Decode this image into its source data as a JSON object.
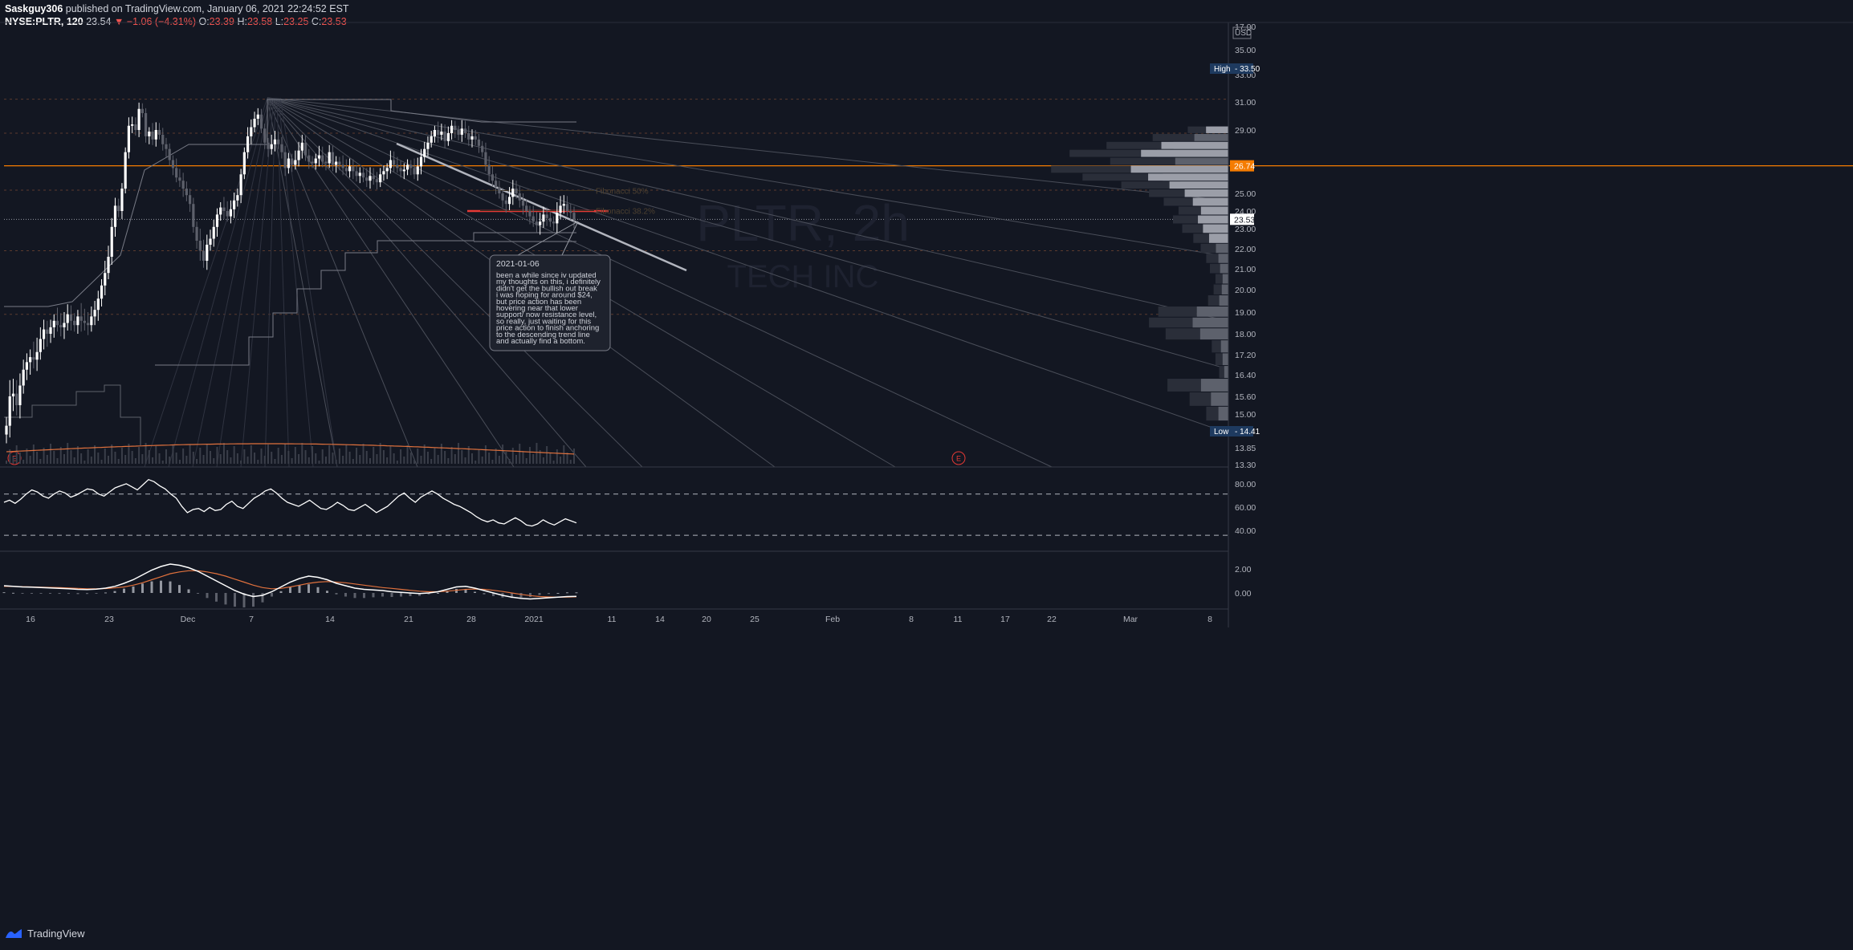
{
  "header": {
    "author": "Saskguy306",
    "published_text": " published on TradingView.com, January 06, 2021 22:24:52 EST",
    "symbol": "NYSE:PLTR, 120",
    "last": "23.54",
    "change": "▼ −1.06 (−4.31%)",
    "o_label": "O:",
    "o_value": "23.39",
    "h_label": "H:",
    "h_value": "23.58",
    "l_label": "L:",
    "l_value": "23.25",
    "c_label": "C:",
    "c_value": "23.53"
  },
  "footer": {
    "brand": "TradingView"
  },
  "colors": {
    "background": "#131722",
    "up_candle": "#ffffff",
    "down_candle": "#5d606b",
    "resistance_line": "#f57c00",
    "red_level": "#e53935",
    "grid_dotted": "#5b3a2e",
    "rsi_line": "#ffffff",
    "macd_line": "#ffffff",
    "signal_line": "#e0713d",
    "volume_ma": "#e0713d"
  },
  "chart_data": {
    "type": "candlestick",
    "symbol": "NYSE:PLTR",
    "interval": "120",
    "currency": "USD",
    "price_axis_ticks": [
      "17.00",
      "35.00",
      "33.00",
      "31.00",
      "29.00",
      "25.00",
      "24.00",
      "23.00",
      "22.00",
      "21.00",
      "20.00",
      "19.00",
      "18.00",
      "17.20",
      "16.40",
      "15.60",
      "15.00",
      "13.85",
      "13.30"
    ],
    "x_tick_labels": [
      "16",
      "23",
      "Dec",
      "7",
      "14",
      "21",
      "28",
      "2021",
      "11",
      "14",
      "20",
      "25",
      "Feb",
      "8",
      "11",
      "17",
      "22",
      "Mar",
      "8"
    ],
    "last_price": 23.53,
    "last_price_label": "23.53",
    "high_label": "High",
    "high_value": "33.50",
    "low_label": "Low",
    "low_value": "14.41",
    "resistance_label": "26.74",
    "resistance_value": 26.74,
    "red_level_value": 24.0,
    "fib_labels": [
      "Fibonacci 50%",
      "Fibonacci 38.2%"
    ],
    "fib_levels": [
      25.18,
      24.02
    ],
    "dotted_levels": [
      31.2,
      28.8,
      25.2,
      21.9,
      18.9
    ],
    "watermark_text": "PLTR, 2h",
    "watermark_subtext": "TECH INC",
    "earnings_marker": "E",
    "note_date": "2021-01-06",
    "note_text": "been a while since iv updated my thoughts on this, i definitely didn't get the bullish out break i was hoping for around $24, but price action has been hovering near that lower support/ now resistance level, so really, just waiting for this price action to finish anchoring to the descending trend line and actually find a bottom.",
    "note_lines": [
      "been a while since iv updated",
      "my thoughts on this, i definitely",
      "didn't get the bullish out break",
      "i was hoping for around $24,",
      "but price action has been",
      "hovering near that lower",
      "support/ now resistance level,",
      "so really, just waiting for this",
      "price action to finish anchoring",
      "to the descending trend line",
      "and actually find a bottom."
    ],
    "closes": [
      14.6,
      15.6,
      15.7,
      15.3,
      16.0,
      16.6,
      16.9,
      17.1,
      17.0,
      17.3,
      17.8,
      18.2,
      18.0,
      18.3,
      18.6,
      18.4,
      18.3,
      18.5,
      18.9,
      18.6,
      18.4,
      18.8,
      18.6,
      18.5,
      18.4,
      18.8,
      19.1,
      19.6,
      20.2,
      20.8,
      21.6,
      23.1,
      24.3,
      24.0,
      25.3,
      27.6,
      29.3,
      29.4,
      29.0,
      30.5,
      30.2,
      28.6,
      28.9,
      28.4,
      29.0,
      28.7,
      28.1,
      27.8,
      27.1,
      26.6,
      26.0,
      25.8,
      25.3,
      24.9,
      24.4,
      23.1,
      22.4,
      21.9,
      21.4,
      22.2,
      22.5,
      23.1,
      23.8,
      24.2,
      24.0,
      23.7,
      24.1,
      24.6,
      24.9,
      26.2,
      27.6,
      28.6,
      29.2,
      29.8,
      30.1,
      29.1,
      28.2,
      27.8,
      28.1,
      28.4,
      28.1,
      27.6,
      26.6,
      27.2,
      26.8,
      27.1,
      27.7,
      28.2,
      27.4,
      27.0,
      26.9,
      27.2,
      27.4,
      27.0,
      26.9,
      27.6,
      26.8,
      27.0,
      26.8,
      26.6,
      26.4,
      26.7,
      26.4,
      26.1,
      26.3,
      26.0,
      25.8,
      26.1,
      25.9,
      25.7,
      26.2,
      26.4,
      26.6,
      27.1,
      26.8,
      26.6,
      26.4,
      26.5,
      26.8,
      26.6,
      26.2,
      26.7,
      27.3,
      27.8,
      28.2,
      28.6,
      29.0,
      28.7,
      28.9,
      28.3,
      28.8,
      29.3,
      29.0,
      28.7,
      29.1,
      28.8,
      28.4,
      28.6,
      28.4,
      28.0,
      27.6,
      26.8,
      26.2,
      25.8,
      25.4,
      25.0,
      24.6,
      24.4,
      24.8,
      25.3,
      25.0,
      24.6,
      24.3,
      24.0,
      23.7,
      23.4,
      23.2,
      23.4,
      23.8,
      23.6,
      23.4,
      23.3,
      23.9,
      24.3,
      24.4,
      24.0,
      23.9,
      23.53
    ],
    "volume_profile_bins": [
      {
        "price": 29.0,
        "volume": 0.22
      },
      {
        "price": 28.5,
        "volume": 0.41
      },
      {
        "price": 28.0,
        "volume": 0.66
      },
      {
        "price": 27.5,
        "volume": 0.86
      },
      {
        "price": 27.0,
        "volume": 0.64
      },
      {
        "price": 26.5,
        "volume": 0.96
      },
      {
        "price": 26.0,
        "volume": 0.79
      },
      {
        "price": 25.5,
        "volume": 0.58
      },
      {
        "price": 25.0,
        "volume": 0.43
      },
      {
        "price": 24.5,
        "volume": 0.35
      },
      {
        "price": 24.0,
        "volume": 0.27
      },
      {
        "price": 23.5,
        "volume": 0.3
      },
      {
        "price": 23.0,
        "volume": 0.25
      },
      {
        "price": 22.5,
        "volume": 0.19
      },
      {
        "price": 22.0,
        "volume": 0.15
      },
      {
        "price": 21.5,
        "volume": 0.12
      },
      {
        "price": 21.0,
        "volume": 0.1
      },
      {
        "price": 20.5,
        "volume": 0.07
      },
      {
        "price": 20.0,
        "volume": 0.08
      },
      {
        "price": 19.5,
        "volume": 0.11
      },
      {
        "price": 19.0,
        "volume": 0.38
      },
      {
        "price": 18.5,
        "volume": 0.43
      },
      {
        "price": 18.0,
        "volume": 0.34
      },
      {
        "price": 17.5,
        "volume": 0.09
      },
      {
        "price": 17.0,
        "volume": 0.07
      },
      {
        "price": 16.5,
        "volume": 0.05
      },
      {
        "price": 16.0,
        "volume": 0.33
      },
      {
        "price": 15.5,
        "volume": 0.21
      },
      {
        "price": 15.0,
        "volume": 0.12
      }
    ],
    "rsi": {
      "levels": [
        70,
        30
      ],
      "ticks": [
        "80.00",
        "60.00",
        "40.00"
      ],
      "values": [
        62,
        64,
        61,
        65,
        70,
        74,
        72,
        68,
        66,
        70,
        73,
        71,
        67,
        69,
        72,
        75,
        74,
        70,
        68,
        72,
        76,
        78,
        80,
        77,
        74,
        79,
        84,
        82,
        78,
        75,
        70,
        66,
        58,
        52,
        55,
        56,
        53,
        57,
        54,
        55,
        60,
        63,
        58,
        56,
        61,
        66,
        69,
        73,
        75,
        71,
        66,
        62,
        60,
        58,
        61,
        64,
        60,
        56,
        55,
        58,
        62,
        59,
        55,
        54,
        57,
        60,
        56,
        52,
        55,
        58,
        63,
        68,
        71,
        66,
        62,
        67,
        70,
        73,
        70,
        66,
        63,
        60,
        58,
        55,
        52,
        48,
        45,
        43,
        45,
        42,
        41,
        44,
        47,
        44,
        40,
        39,
        41,
        45,
        42,
        40,
        43,
        46,
        44,
        42
      ]
    },
    "macd": {
      "ticks": [
        "2.00",
        "0.00"
      ],
      "macd_values": [
        0.6,
        0.55,
        0.5,
        0.48,
        0.45,
        0.42,
        0.38,
        0.35,
        0.3,
        0.28,
        0.32,
        0.4,
        0.55,
        0.8,
        1.1,
        1.5,
        1.9,
        2.2,
        2.4,
        2.3,
        2.1,
        1.8,
        1.4,
        1.0,
        0.6,
        0.2,
        -0.1,
        -0.3,
        -0.2,
        0.1,
        0.5,
        0.9,
        1.2,
        1.4,
        1.3,
        1.1,
        0.8,
        0.6,
        0.4,
        0.3,
        0.25,
        0.2,
        0.1,
        0.05,
        0.0,
        -0.05,
        0.0,
        0.1,
        0.3,
        0.5,
        0.55,
        0.4,
        0.2,
        0.0,
        -0.2,
        -0.35,
        -0.45,
        -0.5,
        -0.45,
        -0.4,
        -0.35,
        -0.3,
        -0.28
      ],
      "signal_values": [
        0.55,
        0.54,
        0.52,
        0.5,
        0.48,
        0.46,
        0.44,
        0.41,
        0.38,
        0.35,
        0.35,
        0.37,
        0.42,
        0.5,
        0.65,
        0.85,
        1.1,
        1.35,
        1.6,
        1.75,
        1.85,
        1.85,
        1.75,
        1.6,
        1.4,
        1.15,
        0.9,
        0.65,
        0.45,
        0.35,
        0.38,
        0.5,
        0.65,
        0.8,
        0.9,
        0.95,
        0.9,
        0.85,
        0.75,
        0.65,
        0.55,
        0.45,
        0.38,
        0.3,
        0.22,
        0.15,
        0.1,
        0.1,
        0.15,
        0.22,
        0.3,
        0.32,
        0.3,
        0.22,
        0.12,
        0.0,
        -0.12,
        -0.22,
        -0.3,
        -0.33,
        -0.35,
        -0.34,
        -0.32
      ]
    }
  }
}
